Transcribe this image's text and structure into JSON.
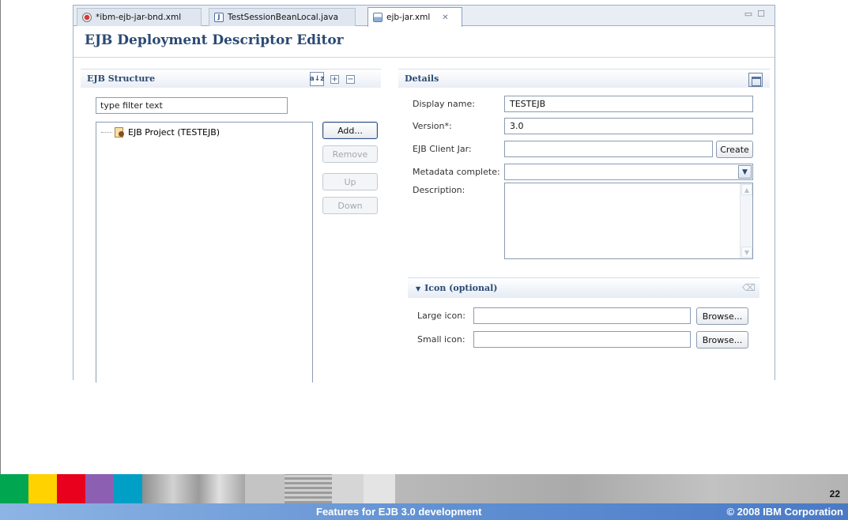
{
  "tabs": [
    {
      "label": "*ibm-ejb-jar-bnd.xml",
      "icon": "xml-file-icon",
      "active": false
    },
    {
      "label": "TestSessionBeanLocal.java",
      "icon": "java-file-icon",
      "active": false
    },
    {
      "label": "ejb-jar.xml",
      "icon": "deployment-descriptor-icon",
      "active": true,
      "close": "✕"
    }
  ],
  "window_controls": {
    "minimize": "▭",
    "maximize": "☐"
  },
  "editor": {
    "title": "EJB Deployment Descriptor Editor"
  },
  "structure": {
    "title": "EJB Structure",
    "filter_value": "type filter text",
    "sort_icon": "a↓z",
    "expand_icon": "+",
    "collapse_icon": "−",
    "tree_items": [
      {
        "label": "EJB Project (TESTEJB)"
      }
    ],
    "buttons": {
      "add": "Add...",
      "remove": "Remove",
      "up": "Up",
      "down": "Down"
    }
  },
  "details": {
    "title": "Details",
    "display_name_label": "Display name:",
    "display_name_value": "TESTEJB",
    "version_label": "Version*:",
    "version_value": "3.0",
    "client_jar_label": "EJB Client Jar:",
    "client_jar_value": "",
    "create_label": "Create",
    "metadata_label": "Metadata complete:",
    "metadata_value": "",
    "description_label": "Description:",
    "icon_section": {
      "title": "Icon (optional)",
      "large_label": "Large icon:",
      "small_label": "Small icon:",
      "browse_label": "Browse..."
    }
  },
  "footer": {
    "title": "Features for EJB 3.0 development",
    "copyright": "© 2008 IBM Corporation",
    "page_number": "22"
  },
  "colors": {
    "strip": [
      "#00a650",
      "#ffd200",
      "#e8001c",
      "#8c5fb2",
      "#00a0c6",
      "#9a9a9a",
      "#bdbdbd",
      "#a8a8a8",
      "#c8c8c8",
      "#d8d8d8",
      "#b0b0b0"
    ]
  }
}
